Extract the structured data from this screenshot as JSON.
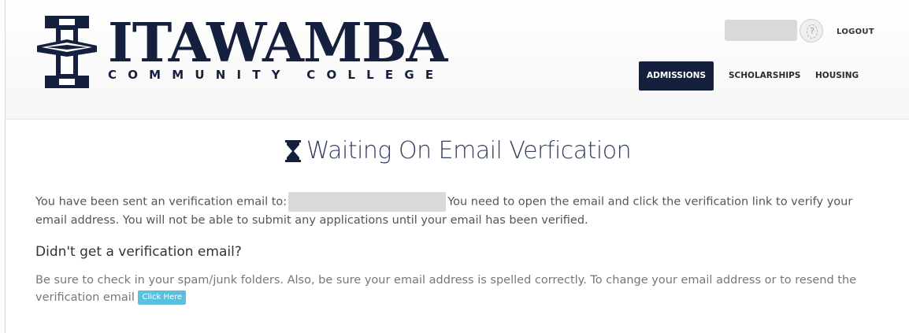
{
  "logo": {
    "name": "ITAWAMBA",
    "subtitle": "COMMUNITY COLLEGE"
  },
  "header": {
    "logout_label": "LOGOUT",
    "nav": [
      {
        "label": "ADMISSIONS",
        "active": true
      },
      {
        "label": "SCHOLARSHIPS",
        "active": false
      },
      {
        "label": "HOUSING",
        "active": false
      }
    ]
  },
  "page": {
    "title": "Waiting On Email Verfication",
    "intro_before": "You have been sent an verification email to:",
    "intro_after": "You need to open the email and click the verification link to verify your email address. You will not be able to submit any applications until your email has been verified.",
    "subheading": "Didn't get a verification email?",
    "help_text": "Be sure to check in your spam/junk folders. Also, be sure your email address is spelled correctly. To change your email address or to resend the verification email",
    "click_here_label": "Click Here"
  },
  "colors": {
    "brand_navy": "#15203f",
    "button_info": "#5bc0de"
  },
  "icons": {
    "title_icon": "hourglass-icon",
    "avatar": "user-placeholder-icon"
  }
}
